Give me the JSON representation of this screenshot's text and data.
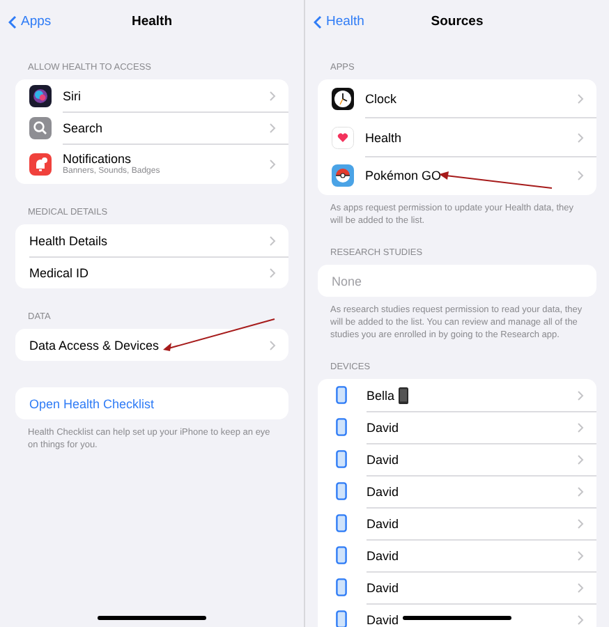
{
  "panes": [
    {
      "nav": {
        "back": "Apps",
        "title": "Health"
      },
      "sections": [
        {
          "header": "ALLOW HEALTH TO ACCESS",
          "rows": [
            {
              "kind": "siri",
              "label": "Siri",
              "chevron": true
            },
            {
              "kind": "search",
              "label": "Search",
              "chevron": true
            },
            {
              "kind": "notifications",
              "label": "Notifications",
              "subtitle": "Banners, Sounds, Badges",
              "chevron": true
            }
          ]
        },
        {
          "header": "MEDICAL DETAILS",
          "rows": [
            {
              "kind": "plain",
              "label": "Health Details",
              "chevron": true
            },
            {
              "kind": "plain",
              "label": "Medical ID",
              "chevron": true
            }
          ]
        },
        {
          "header": "DATA",
          "rows": [
            {
              "kind": "plain",
              "label": "Data Access & Devices",
              "chevron": true
            }
          ]
        },
        {
          "rows": [
            {
              "kind": "link",
              "label": "Open Health Checklist",
              "chevron": false
            }
          ],
          "footer": "Health Checklist can help set up your iPhone to keep an eye on things for you."
        }
      ]
    },
    {
      "nav": {
        "back": "Health",
        "title": "Sources"
      },
      "sections": [
        {
          "header": "APPS",
          "rows": [
            {
              "kind": "clock",
              "label": "Clock",
              "chevron": true
            },
            {
              "kind": "health",
              "label": "Health",
              "chevron": true
            },
            {
              "kind": "game",
              "label": "Pokémon GO",
              "chevron": true
            }
          ],
          "footer": "As apps request permission to update your Health data, they will be added to the list."
        },
        {
          "header": "RESEARCH STUDIES",
          "rows": [
            {
              "kind": "placeholder",
              "label": "None",
              "chevron": false
            }
          ],
          "footer": "As research studies request permission to read your data, they will be added to the list. You can review and manage all of the studies you are enrolled in by going to the Research app."
        },
        {
          "header": "DEVICES",
          "rows": [
            {
              "kind": "device",
              "label": "Bella",
              "tag_icon": true,
              "chevron": true
            },
            {
              "kind": "device",
              "label": "David",
              "chevron": true
            },
            {
              "kind": "device",
              "label": "David",
              "chevron": true
            },
            {
              "kind": "device",
              "label": "David",
              "chevron": true
            },
            {
              "kind": "device",
              "label": "David",
              "chevron": true
            },
            {
              "kind": "device",
              "label": "David",
              "chevron": true
            },
            {
              "kind": "device",
              "label": "David",
              "chevron": true
            },
            {
              "kind": "device",
              "label": "David",
              "chevron": true
            }
          ]
        }
      ]
    }
  ]
}
